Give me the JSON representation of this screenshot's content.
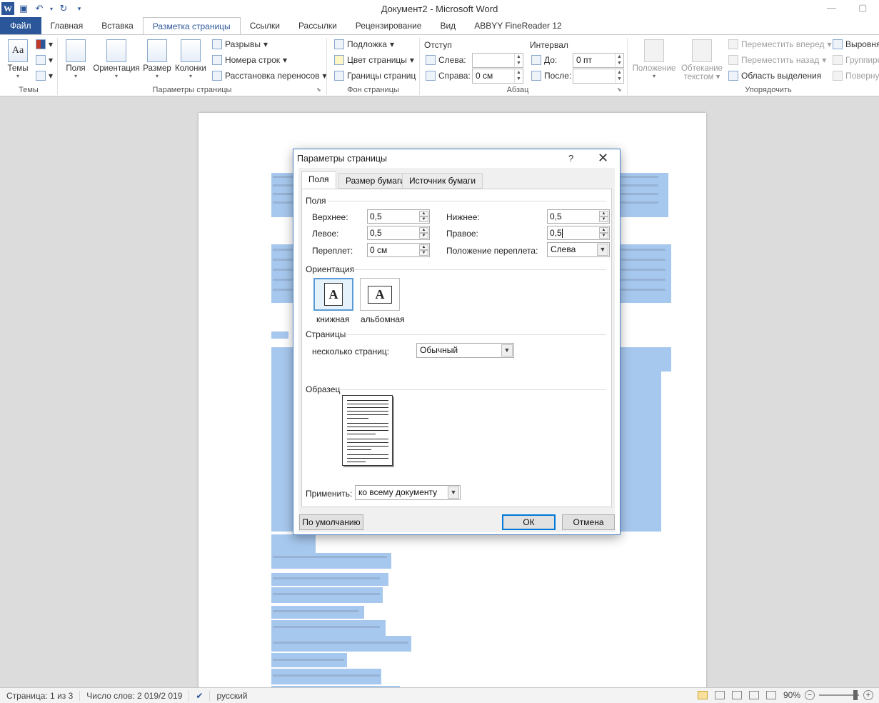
{
  "window": {
    "title": "Документ2 - Microsoft Word",
    "app_logo": "W",
    "minimize": "—",
    "restore": "▢"
  },
  "tabs": [
    "Файл",
    "Главная",
    "Вставка",
    "Разметка страницы",
    "Ссылки",
    "Рассылки",
    "Рецензирование",
    "Вид",
    "ABBYY FineReader 12"
  ],
  "active_tab": "Разметка страницы",
  "ribbon": {
    "themes": {
      "label": "Темы",
      "group": "Темы"
    },
    "page_setup": {
      "group": "Параметры страницы",
      "fields": "Поля",
      "orientation": "Ориентация",
      "size": "Размер",
      "columns": "Колонки",
      "breaks": "Разрывы",
      "line_numbers": "Номера строк",
      "hyphenation": "Расстановка переносов"
    },
    "page_background": {
      "group": "Фон страницы",
      "watermark": "Подложка",
      "page_color": "Цвет страницы",
      "page_borders": "Границы страниц"
    },
    "paragraph": {
      "group": "Абзац",
      "indent": "Отступ",
      "left": "Слева:",
      "left_value": "",
      "right": "Справа:",
      "right_value": "0 см",
      "spacing": "Интервал",
      "before": "До:",
      "before_value": "0 пт",
      "after": "После:",
      "after_value": ""
    },
    "arrange": {
      "group": "Упорядочить",
      "position": "Положение",
      "wrap_line1": "Обтекание",
      "wrap_line2": "текстом",
      "bring_forward": "Переместить вперед",
      "send_backward": "Переместить назад",
      "selection_pane": "Область выделения",
      "align": "Выровнять",
      "group_btn": "Группировать",
      "rotate": "Повернуть"
    }
  },
  "statusbar": {
    "page": "Страница: 1 из 3",
    "words": "Число слов: 2 019/2 019",
    "language": "русский",
    "zoom": "90%"
  },
  "dialog": {
    "title": "Параметры страницы",
    "help": "?",
    "close": "✕",
    "tabs": [
      "Поля",
      "Размер бумаги",
      "Источник бумаги"
    ],
    "active_tab": "Поля",
    "margins_section": "Поля",
    "top_label": "Верхнее:",
    "top_value": "0,5",
    "bottom_label": "Нижнее:",
    "bottom_value": "0,5",
    "left_label": "Левое:",
    "left_value": "0,5",
    "right_label": "Правое:",
    "right_value": "0,5",
    "gutter_label": "Переплет:",
    "gutter_value": "0 см",
    "gutter_pos_label": "Положение переплета:",
    "gutter_pos_value": "Слева",
    "orientation_section": "Ориентация",
    "portrait": "книжная",
    "landscape": "альбомная",
    "pages_section": "Страницы",
    "multiple_pages_label": "несколько страниц:",
    "multiple_pages_value": "Обычный",
    "preview_section": "Образец",
    "apply_label": "Применить:",
    "apply_value": "ко всему документу",
    "default_button": "По умолчанию",
    "ok_button": "ОК",
    "cancel_button": "Отмена"
  }
}
